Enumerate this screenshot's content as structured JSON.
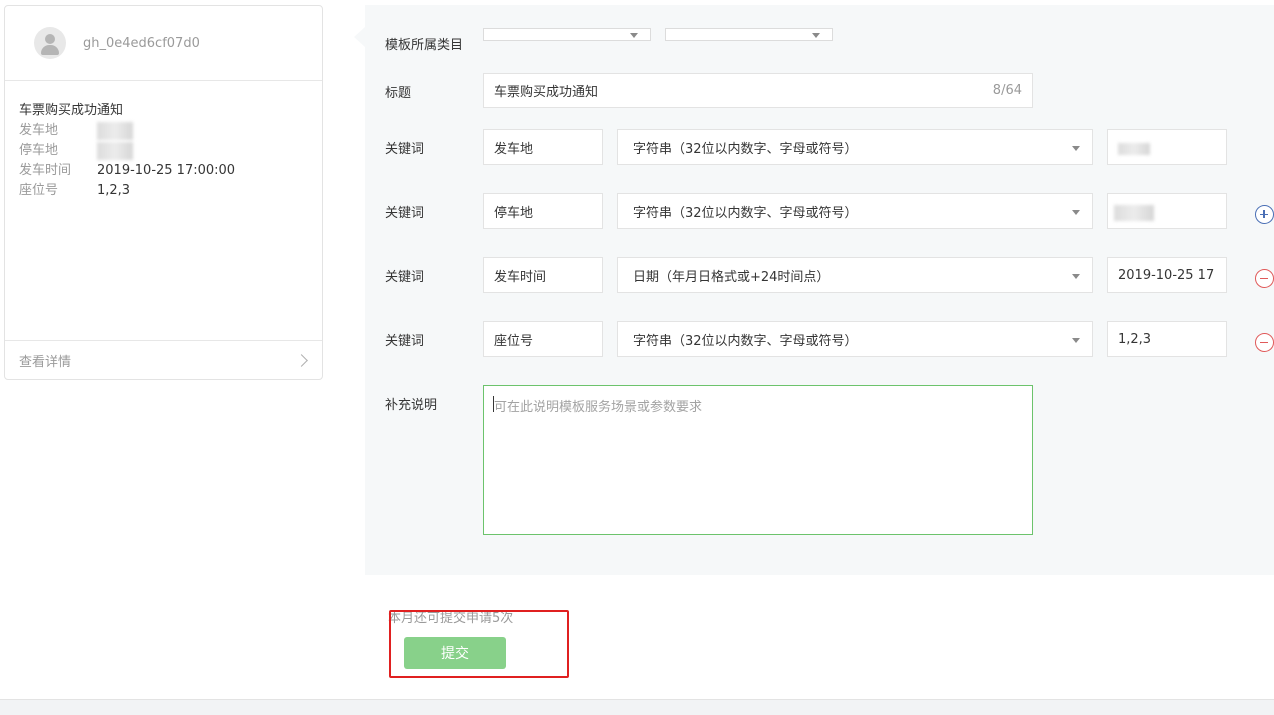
{
  "preview": {
    "account": "gh_0e4ed6cf07d0",
    "message_title": "车票购买成功通知",
    "rows": [
      {
        "key": "发车地",
        "value": ""
      },
      {
        "key": "停车地",
        "value": ""
      },
      {
        "key": "发车时间",
        "value": "2019-10-25 17:00:00"
      },
      {
        "key": "座位号",
        "value": "1,2,3"
      }
    ],
    "view_details": "查看详情"
  },
  "form": {
    "category_label": "模板所属类目",
    "category_primary": "",
    "category_secondary": "",
    "title_label": "标题",
    "title_value": "车票购买成功通知",
    "title_counter": "8/64",
    "keyword_label": "关键词",
    "keywords": [
      {
        "name": "发车地",
        "type": "字符串（32位以内数字、字母或符号）",
        "example": ""
      },
      {
        "name": "停车地",
        "type": "字符串（32位以内数字、字母或符号）",
        "example": ""
      },
      {
        "name": "发车时间",
        "type": "日期（年月日格式或+24时间点）",
        "example": "2019-10-25 17"
      },
      {
        "name": "座位号",
        "type": "字符串（32位以内数字、字母或符号）",
        "example": "1,2,3"
      }
    ],
    "notes_label": "补充说明",
    "notes_placeholder": "可在此说明模板服务场景或参数要求"
  },
  "footer": {
    "remaining_text": "本月还可提交申请5次",
    "submit_label": "提交"
  },
  "colors": {
    "submit_bg": "#88d18a",
    "highlight": "#e02020",
    "add_icon": "#4a6fb5",
    "remove_icon": "#e05a5a",
    "textarea_focus": "#6cc36c"
  }
}
